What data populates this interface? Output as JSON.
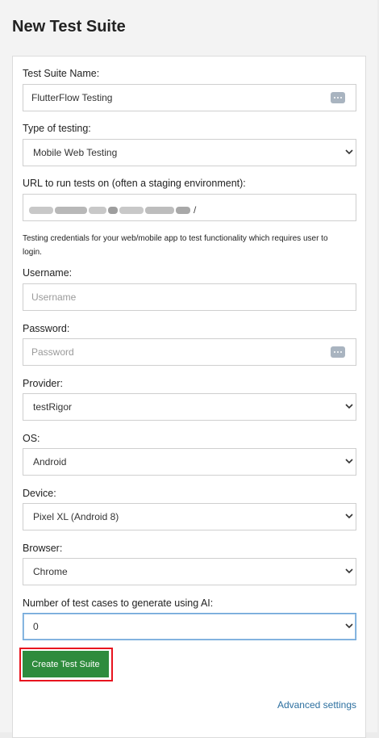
{
  "page": {
    "title": "New Test Suite"
  },
  "form": {
    "name": {
      "label": "Test Suite Name:",
      "value": "FlutterFlow Testing"
    },
    "type": {
      "label": "Type of testing:",
      "value": "Mobile Web Testing"
    },
    "url": {
      "label": "URL to run tests on (often a staging environment):",
      "value_suffix": "/"
    },
    "credentials_note": "Testing credentials for your web/mobile app to test functionality which requires user to login.",
    "username": {
      "label": "Username:",
      "placeholder": "Username"
    },
    "password": {
      "label": "Password:",
      "placeholder": "Password"
    },
    "provider": {
      "label": "Provider:",
      "value": "testRigor"
    },
    "os": {
      "label": "OS:",
      "value": "Android"
    },
    "device": {
      "label": "Device:",
      "value": "Pixel XL (Android 8)"
    },
    "browser": {
      "label": "Browser:",
      "value": "Chrome"
    },
    "ai_cases": {
      "label": "Number of test cases to generate using AI:",
      "value": "0"
    }
  },
  "actions": {
    "create_label": "Create Test Suite",
    "advanced_label": "Advanced settings"
  },
  "icons": {
    "password_manager": "dots-icon",
    "dropdown": "chevron-down-icon"
  },
  "colors": {
    "primary_button": "#2e8b3d",
    "highlight": "#e8141e",
    "link": "#2c6f9f"
  }
}
